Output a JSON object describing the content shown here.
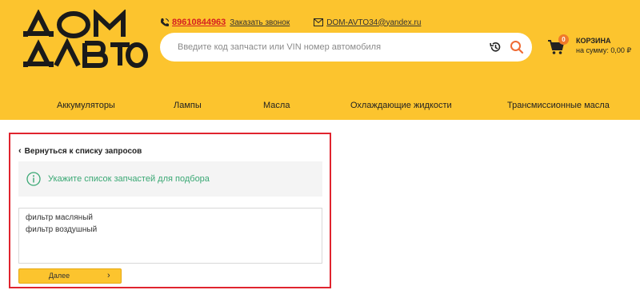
{
  "header": {
    "logo_text": "ДОМ АВТО",
    "phone": "89610844963",
    "callback_label": "Заказать звонок",
    "email": "DOM-AVTO34@yandex.ru",
    "search": {
      "placeholder": "Введите код запчасти или VIN номер автомобиля"
    },
    "cart": {
      "count": "0",
      "title": "КОРЗИНА",
      "sum": "на сумму: 0,00 ₽"
    }
  },
  "nav": {
    "items": [
      {
        "label": "Аккумуляторы"
      },
      {
        "label": "Лампы"
      },
      {
        "label": "Масла"
      },
      {
        "label": "Охлаждающие жидкости"
      },
      {
        "label": "Трансмиссионные масла"
      }
    ]
  },
  "panel": {
    "back_label": "Вернуться к списку запросов",
    "info_text": "Укажите список запчастей для подбора",
    "parts_value": "фильтр масляный\nфильтр воздушный",
    "next_label": "Далее"
  },
  "colors": {
    "brand_yellow": "#fcc42e",
    "accent_red": "#e0242e",
    "info_green": "#3aa874",
    "badge_orange": "#f07a2a"
  }
}
